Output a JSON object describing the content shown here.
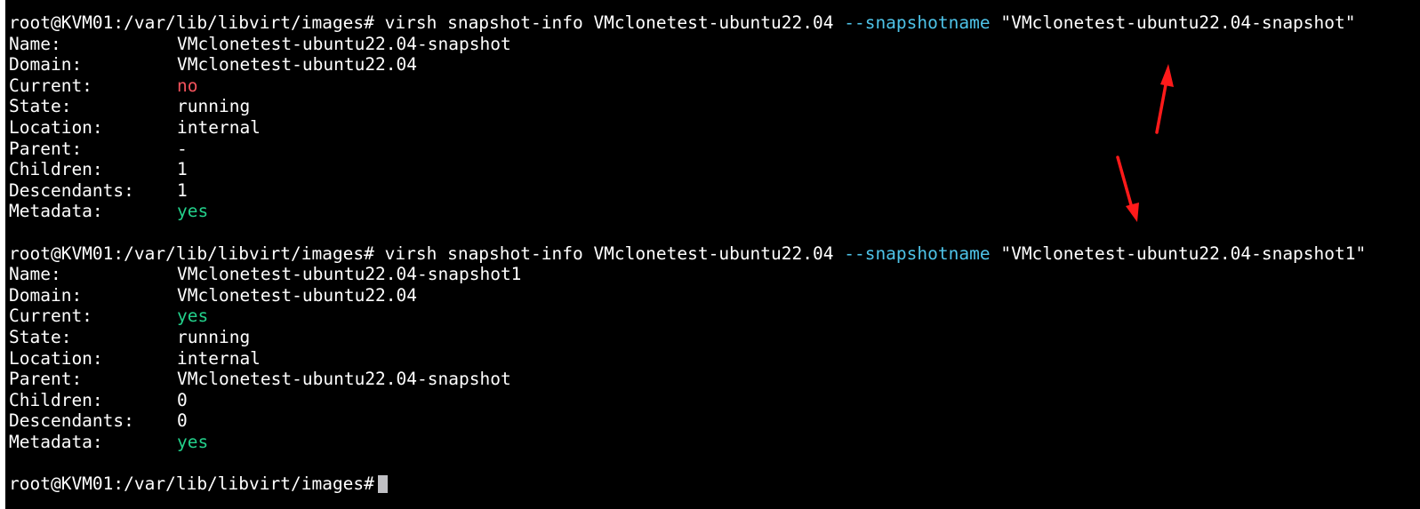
{
  "terminal": {
    "block1": {
      "command": {
        "prompt": "root@KVM01:/var/lib/libvirt/images#",
        "pre": " virsh snapshot-info VMclonetest-ubuntu22.04 ",
        "option": "--snapshotname",
        "arg": " \"VMclonetest-ubuntu22.04-snapshot\""
      },
      "fields": [
        {
          "label": "Name:",
          "value": "VMclonetest-ubuntu22.04-snapshot"
        },
        {
          "label": "Domain:",
          "value": "VMclonetest-ubuntu22.04"
        },
        {
          "label": "Current:",
          "value": "no",
          "color": "#f1525b"
        },
        {
          "label": "State:",
          "value": "running"
        },
        {
          "label": "Location:",
          "value": "internal"
        },
        {
          "label": "Parent:",
          "value": "-"
        },
        {
          "label": "Children:",
          "value": "1"
        },
        {
          "label": "Descendants:",
          "value": "1"
        },
        {
          "label": "Metadata:",
          "value": "yes",
          "color": "#23d18b"
        }
      ]
    },
    "block2": {
      "command": {
        "prompt": "root@KVM01:/var/lib/libvirt/images#",
        "pre": " virsh snapshot-info VMclonetest-ubuntu22.04 ",
        "option": "--snapshotname",
        "arg": " \"VMclonetest-ubuntu22.04-snapshot1\""
      },
      "fields": [
        {
          "label": "Name:",
          "value": "VMclonetest-ubuntu22.04-snapshot1"
        },
        {
          "label": "Domain:",
          "value": "VMclonetest-ubuntu22.04"
        },
        {
          "label": "Current:",
          "value": "yes",
          "color": "#23d18b"
        },
        {
          "label": "State:",
          "value": "running"
        },
        {
          "label": "Location:",
          "value": "internal"
        },
        {
          "label": "Parent:",
          "value": "VMclonetest-ubuntu22.04-snapshot"
        },
        {
          "label": "Children:",
          "value": "0"
        },
        {
          "label": "Descendants:",
          "value": "0"
        },
        {
          "label": "Metadata:",
          "value": "yes",
          "color": "#23d18b"
        }
      ]
    },
    "final_prompt": "root@KVM01:/var/lib/libvirt/images#"
  },
  "colors": {
    "background": "#000000",
    "text": "#ffffff",
    "option": "#4ec3e8",
    "no": "#f1525b",
    "yes": "#23d18b",
    "annotation_arrow": "#ff1a1a"
  }
}
